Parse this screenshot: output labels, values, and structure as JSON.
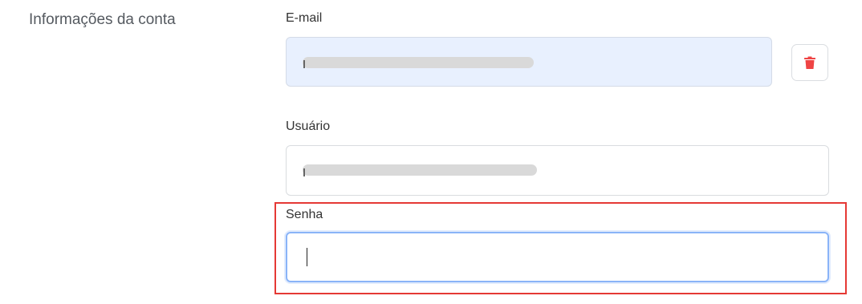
{
  "section": {
    "title": "Informações da conta"
  },
  "fields": {
    "email": {
      "label": "E-mail",
      "value": ""
    },
    "username": {
      "label": "Usuário",
      "value": ""
    },
    "password": {
      "label": "Senha",
      "value": ""
    }
  },
  "actions": {
    "delete_icon": "trash-icon"
  },
  "colors": {
    "highlight": "#e53935",
    "delete": "#ef4444",
    "autofill_bg": "#e8f0fe",
    "focus_border": "#8ab4f8"
  }
}
